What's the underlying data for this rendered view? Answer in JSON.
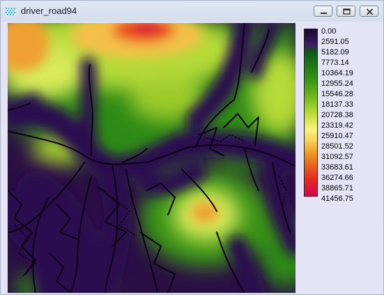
{
  "window": {
    "title": "driver_road94",
    "controls": [
      "minimize",
      "restore",
      "close"
    ]
  },
  "map": {
    "description_icons": "raster-map"
  },
  "legend": {
    "labels": [
      "0.00",
      "2591.05",
      "5182.09",
      "7773.14",
      "10364.19",
      "12955.24",
      "15546.28",
      "18137.33",
      "20728.38",
      "23319.42",
      "25910.47",
      "28501.52",
      "31092.57",
      "33683.61",
      "36274.66",
      "38865.71",
      "41456.75"
    ],
    "colors": [
      "#1c0a2e",
      "#3b1b6a",
      "#0e5a16",
      "#3e9a14",
      "#c8e03c",
      "#f7f47c",
      "#ef9c28",
      "#e52a22",
      "#d1064a"
    ]
  }
}
